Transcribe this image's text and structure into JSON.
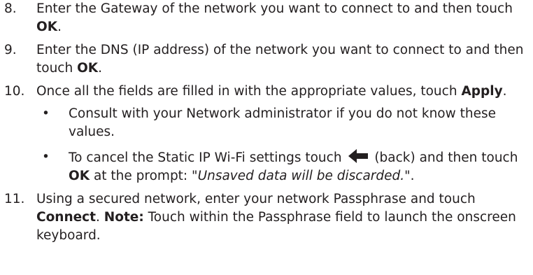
{
  "steps": [
    {
      "number": "8.",
      "text1": "Enter the Gateway of the network you want to connect to and then touch ",
      "bold1": "OK",
      "text2": "."
    },
    {
      "number": "9.",
      "text1": "Enter the DNS (IP address) of the network you want to connect to and then touch ",
      "bold1": "OK",
      "text2": "."
    },
    {
      "number": "10.",
      "text1": "Once all the fields are filled in with the appropriate values, touch ",
      "bold1": "Apply",
      "text2": ".",
      "bullets": [
        {
          "dot": "•",
          "text": "Consult with your Network administrator if you do not know these values."
        },
        {
          "dot": "•",
          "text1": "To cancel the Static IP Wi-Fi settings touch ",
          "icon": "back-arrow-icon",
          "text2": " (back) and then touch ",
          "bold1": "OK",
          "text3": " at the prompt: \"",
          "italic1": "Unsaved data will be discarded.",
          "text4": "\"."
        }
      ]
    },
    {
      "number": "11.",
      "text1": "Using a secured network, enter your network Passphrase and touch ",
      "bold1": "Connect",
      "text2": ". ",
      "bold2": "Note:",
      "text3": " Touch within the Passphrase field to launch the onscreen keyboard."
    }
  ],
  "colors": {
    "text": "#231f20",
    "icon": "#231f20"
  }
}
